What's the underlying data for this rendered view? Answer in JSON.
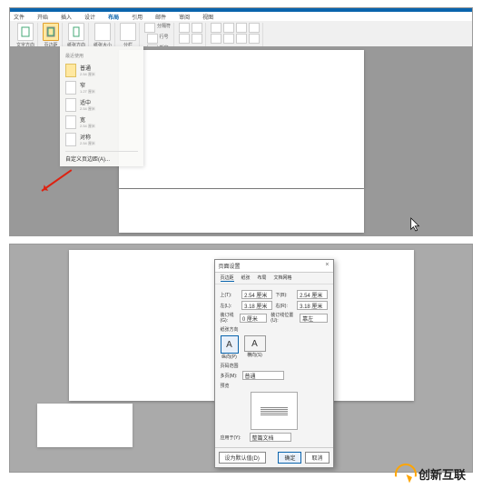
{
  "app": {
    "tabs": [
      "文件",
      "开始",
      "插入",
      "设计",
      "布局",
      "引用",
      "邮件",
      "审阅",
      "视图"
    ],
    "active_tab": "布局"
  },
  "ribbon": {
    "groups": [
      {
        "label": "文字方向"
      },
      {
        "label": "页边距"
      },
      {
        "label": "纸张方向"
      },
      {
        "label": "纸张大小"
      },
      {
        "label": "分栏"
      },
      {
        "label": "分隔符"
      },
      {
        "label": "行号"
      },
      {
        "label": "断字"
      }
    ]
  },
  "margins_menu": {
    "section1": "最近使用",
    "items": [
      {
        "name": "普通",
        "t": "2.54 厘米",
        "b": "2.54 厘米",
        "l": "3.18 厘米",
        "r": "3.18 厘米",
        "hl": true
      },
      {
        "name": "窄",
        "t": "1.27 厘米",
        "b": "1.27 厘米",
        "l": "1.27 厘米",
        "r": "1.27 厘米"
      },
      {
        "name": "适中",
        "t": "2.54 厘米",
        "b": "2.54 厘米",
        "l": "1.91 厘米",
        "r": "1.91 厘米"
      },
      {
        "name": "宽",
        "t": "2.54 厘米",
        "b": "2.54 厘米",
        "l": "5.08 厘米",
        "r": "5.08 厘米"
      },
      {
        "name": "对称",
        "t": "2.54 厘米",
        "b": "2.54 厘米",
        "l": "3.18 厘米",
        "r": "2.54 厘米"
      }
    ],
    "custom": "自定义页边距(A)..."
  },
  "dialog": {
    "title": "页面设置",
    "close": "×",
    "tabs": [
      "页边距",
      "纸张",
      "布局",
      "文档网格"
    ],
    "fields": {
      "top_label": "上(T):",
      "top": "2.54 厘米",
      "bottom_label": "下(B):",
      "bottom": "2.54 厘米",
      "left_label": "左(L):",
      "left": "3.18 厘米",
      "right_label": "右(R):",
      "right": "3.18 厘米",
      "gutter_label": "装订线(G):",
      "gutter": "0 厘米",
      "gutter_pos_label": "装订线位置(U):",
      "gutter_pos": "靠左"
    },
    "orientation_label": "纸张方向",
    "orient_portrait": "纵向(P)",
    "orient_landscape": "横向(S)",
    "pages_label": "页码范围",
    "multi_label": "多页(M):",
    "multi_value": "普通",
    "preview_label": "预览",
    "apply_label": "应用于(Y):",
    "apply_value": "整篇文档",
    "default_btn": "设为默认值(D)",
    "ok": "确定",
    "cancel": "取消"
  },
  "watermark": {
    "text": "创新互联"
  }
}
